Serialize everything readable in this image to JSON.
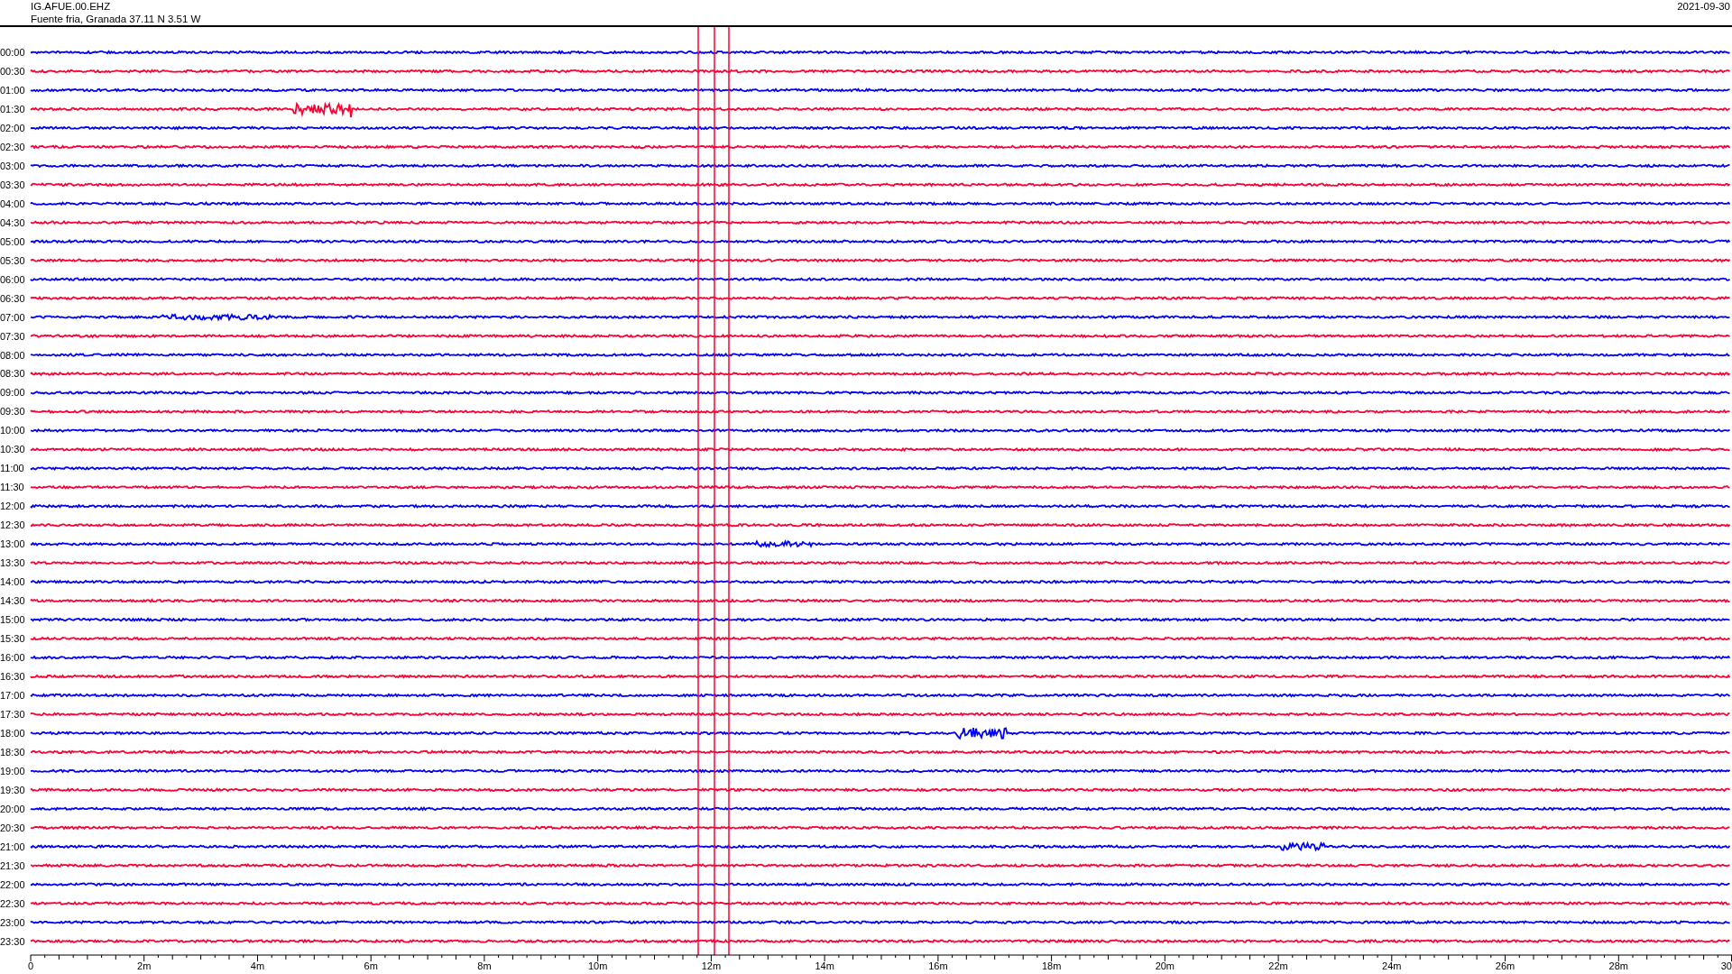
{
  "header": {
    "station": "IG.AFUE.00.EHZ",
    "location": "Fuente fria, Granada  37.11 N 3.51 W",
    "date": "2021-09-30"
  },
  "traces": [
    {
      "label": "00:00",
      "color": "#0000ff"
    },
    {
      "label": "00:30",
      "color": "#ff0033"
    },
    {
      "label": "01:00",
      "color": "#0000ff"
    },
    {
      "label": "01:30",
      "color": "#ff0033"
    },
    {
      "label": "02:00",
      "color": "#0000ff"
    },
    {
      "label": "02:30",
      "color": "#ff0033"
    },
    {
      "label": "03:00",
      "color": "#0000ff"
    },
    {
      "label": "03:30",
      "color": "#ff0033"
    },
    {
      "label": "04:00",
      "color": "#0000ff"
    },
    {
      "label": "04:30",
      "color": "#ff0033"
    },
    {
      "label": "05:00",
      "color": "#0000ff"
    },
    {
      "label": "05:30",
      "color": "#ff0033"
    },
    {
      "label": "06:00",
      "color": "#0000ff"
    },
    {
      "label": "06:30",
      "color": "#ff0033"
    },
    {
      "label": "07:00",
      "color": "#0000ff"
    },
    {
      "label": "07:30",
      "color": "#ff0033"
    },
    {
      "label": "08:00",
      "color": "#0000ff"
    },
    {
      "label": "08:30",
      "color": "#ff0033"
    },
    {
      "label": "09:00",
      "color": "#0000ff"
    },
    {
      "label": "09:30",
      "color": "#ff0033"
    },
    {
      "label": "10:00",
      "color": "#0000ff"
    },
    {
      "label": "10:30",
      "color": "#ff0033"
    },
    {
      "label": "11:00",
      "color": "#0000ff"
    },
    {
      "label": "11:30",
      "color": "#ff0033"
    },
    {
      "label": "12:00",
      "color": "#0000ff"
    },
    {
      "label": "12:30",
      "color": "#ff0033"
    },
    {
      "label": "13:00",
      "color": "#0000ff"
    },
    {
      "label": "13:30",
      "color": "#ff0033"
    },
    {
      "label": "14:00",
      "color": "#0000ff"
    },
    {
      "label": "14:30",
      "color": "#ff0033"
    },
    {
      "label": "15:00",
      "color": "#0000ff"
    },
    {
      "label": "15:30",
      "color": "#ff0033"
    },
    {
      "label": "16:00",
      "color": "#0000ff"
    },
    {
      "label": "16:30",
      "color": "#ff0033"
    },
    {
      "label": "17:00",
      "color": "#0000ff"
    },
    {
      "label": "17:30",
      "color": "#ff0033"
    },
    {
      "label": "18:00",
      "color": "#0000ff"
    },
    {
      "label": "18:30",
      "color": "#ff0033"
    },
    {
      "label": "19:00",
      "color": "#0000ff"
    },
    {
      "label": "19:30",
      "color": "#ff0033"
    },
    {
      "label": "20:00",
      "color": "#0000ff"
    },
    {
      "label": "20:30",
      "color": "#ff0033"
    },
    {
      "label": "21:00",
      "color": "#0000ff"
    },
    {
      "label": "21:30",
      "color": "#ff0033"
    },
    {
      "label": "22:00",
      "color": "#0000ff"
    },
    {
      "label": "22:30",
      "color": "#ff0033"
    },
    {
      "label": "23:00",
      "color": "#0000ff"
    },
    {
      "label": "23:30",
      "color": "#ff0033"
    }
  ],
  "x_axis": {
    "ticks": [
      "0",
      "2m",
      "4m",
      "6m",
      "8m",
      "10m",
      "12m",
      "14m",
      "16m",
      "18m",
      "20m",
      "22m",
      "24m",
      "26m",
      "28m",
      "30"
    ]
  }
}
